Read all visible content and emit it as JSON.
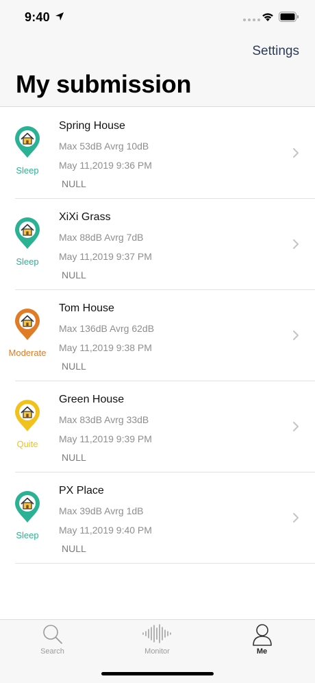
{
  "status_bar": {
    "time": "9:40"
  },
  "nav": {
    "settings_label": "Settings",
    "title": "My submission"
  },
  "submissions": [
    {
      "place": "Spring House",
      "stats": "Max 53dB Avrg 10dB",
      "date": "May 11,2019 9:36 PM",
      "note": "NULL",
      "level": "Sleep",
      "color": "#2bb193"
    },
    {
      "place": "XiXi Grass",
      "stats": "Max 88dB Avrg 7dB",
      "date": "May 11,2019 9:37 PM",
      "note": "NULL",
      "level": "Sleep",
      "color": "#2bb193"
    },
    {
      "place": "Tom House",
      "stats": "Max 136dB Avrg 62dB",
      "date": "May 11,2019 9:38 PM",
      "note": "NULL",
      "level": "Moderate",
      "color": "#e07b26"
    },
    {
      "place": "Green House",
      "stats": "Max 83dB Avrg 33dB",
      "date": "May 11,2019 9:39 PM",
      "note": "NULL",
      "level": "Quite",
      "color": "#f1c21b"
    },
    {
      "place": "PX Place",
      "stats": "Max 39dB Avrg 1dB",
      "date": "May 11,2019 9:40 PM",
      "note": "NULL",
      "level": "Sleep",
      "color": "#2bb193"
    }
  ],
  "tabs": [
    {
      "label": "Search",
      "icon": "magnifier-icon",
      "active": false
    },
    {
      "label": "Monitor",
      "icon": "sound-wave-icon",
      "active": false
    },
    {
      "label": "Me",
      "icon": "person-icon",
      "active": true
    }
  ]
}
